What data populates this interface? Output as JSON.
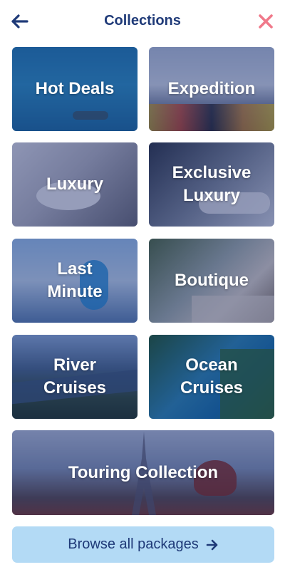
{
  "header": {
    "title": "Collections",
    "back_icon": "arrow-left-icon",
    "close_icon": "close-icon",
    "title_color": "#1f3a78",
    "close_color": "#f0798a"
  },
  "collections": [
    {
      "label": "Hot Deals"
    },
    {
      "label": "Expedition"
    },
    {
      "label": "Luxury"
    },
    {
      "label": "Exclusive\nLuxury"
    },
    {
      "label": "Last\nMinute"
    },
    {
      "label": "Boutique"
    },
    {
      "label": "River\nCruises"
    },
    {
      "label": "Ocean\nCruises"
    },
    {
      "label": "Touring Collection"
    }
  ],
  "browse_button": {
    "label": "Browse all packages",
    "icon": "arrow-right-icon",
    "background": "#b3daf5"
  }
}
